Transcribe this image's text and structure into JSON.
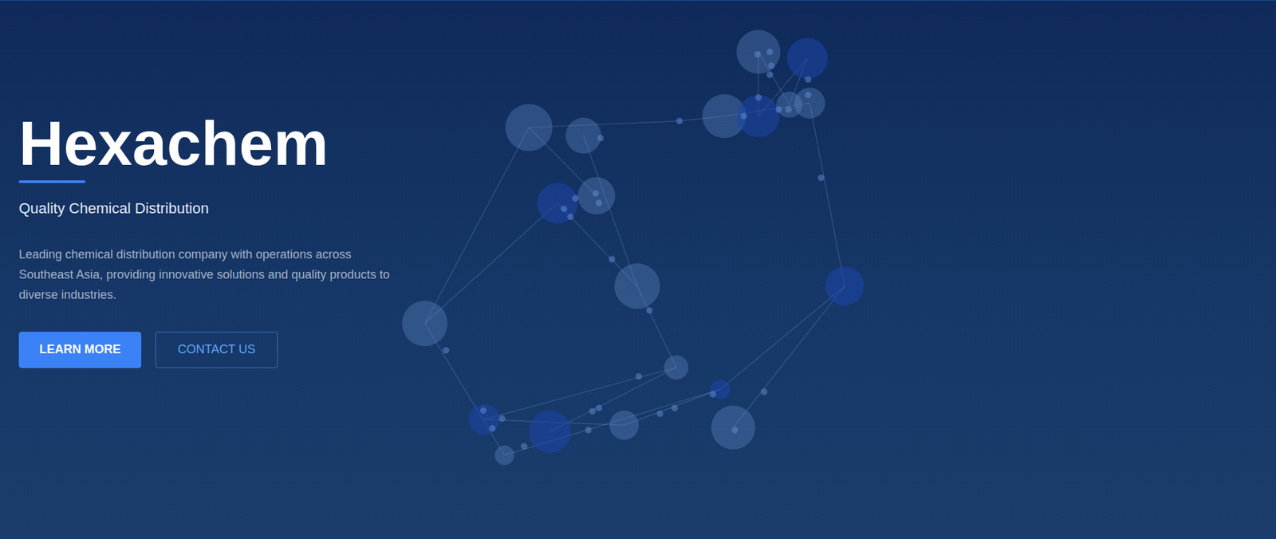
{
  "hero": {
    "title": "Hexachem",
    "subtitle": "Quality Chemical Distribution",
    "description": "Leading chemical distribution company with operations across Southeast Asia, providing innovative solutions and quality products to diverse industries.",
    "buttons": [
      {
        "label": "LEARN MORE",
        "kind": "primary"
      },
      {
        "label": "CONTACT US",
        "kind": "outline"
      }
    ]
  }
}
